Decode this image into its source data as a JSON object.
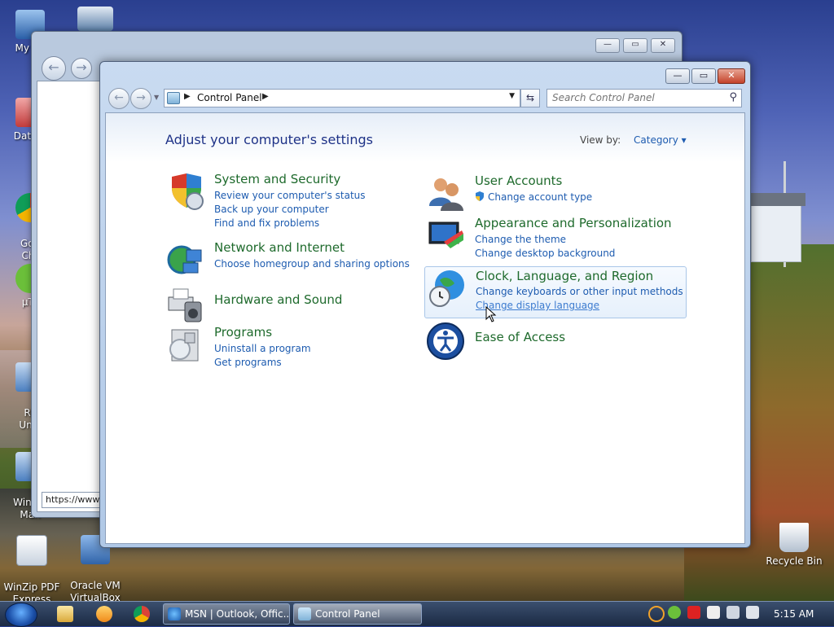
{
  "desktop": {
    "icons": [
      {
        "label": "My Co",
        "color": "#3a78c8"
      },
      {
        "label": "DataW",
        "color": "#c23b3b"
      },
      {
        "label": "Goo\nChr",
        "color": "#3aa34a"
      },
      {
        "label": "µTo",
        "color": "#6bbf3a"
      },
      {
        "label": "Re\nUnin",
        "color": "#4b7fc0"
      },
      {
        "label": "WinZip\nMan",
        "color": "#4b7fc0"
      },
      {
        "label": "WinZip PDF\nExpress",
        "color": "#d0d8e4"
      },
      {
        "label": "Oracle VM\nVirtualBox",
        "color": "#2f63a8"
      },
      {
        "label": "Recycle Bin",
        "color": "#cfd8e2"
      }
    ]
  },
  "back_window": {
    "url_partial": "https://www"
  },
  "window": {
    "breadcrumb": "Control Panel",
    "search_placeholder": "Search Control Panel",
    "heading": "Adjust your computer's settings",
    "view_by_label": "View by:",
    "view_by_value": "Category ▾"
  },
  "categories": {
    "system": {
      "title": "System and Security",
      "links": [
        "Review your computer's status",
        "Back up your computer",
        "Find and fix problems"
      ]
    },
    "network": {
      "title": "Network and Internet",
      "links": [
        "Choose homegroup and sharing options"
      ]
    },
    "hardware": {
      "title": "Hardware and Sound",
      "links": []
    },
    "programs": {
      "title": "Programs",
      "links": [
        "Uninstall a program",
        "Get programs"
      ]
    },
    "users": {
      "title": "User Accounts",
      "links": [
        "Change account type"
      ]
    },
    "appearance": {
      "title": "Appearance and Personalization",
      "links": [
        "Change the theme",
        "Change desktop background"
      ]
    },
    "clock": {
      "title": "Clock, Language, and Region",
      "links": [
        "Change keyboards or other input methods",
        "Change display language"
      ]
    },
    "ease": {
      "title": "Ease of Access",
      "links": []
    }
  },
  "taskbar": {
    "buttons": [
      "MSN | Outlook, Offic...",
      "Control Panel"
    ],
    "clock": "5:15 AM"
  }
}
